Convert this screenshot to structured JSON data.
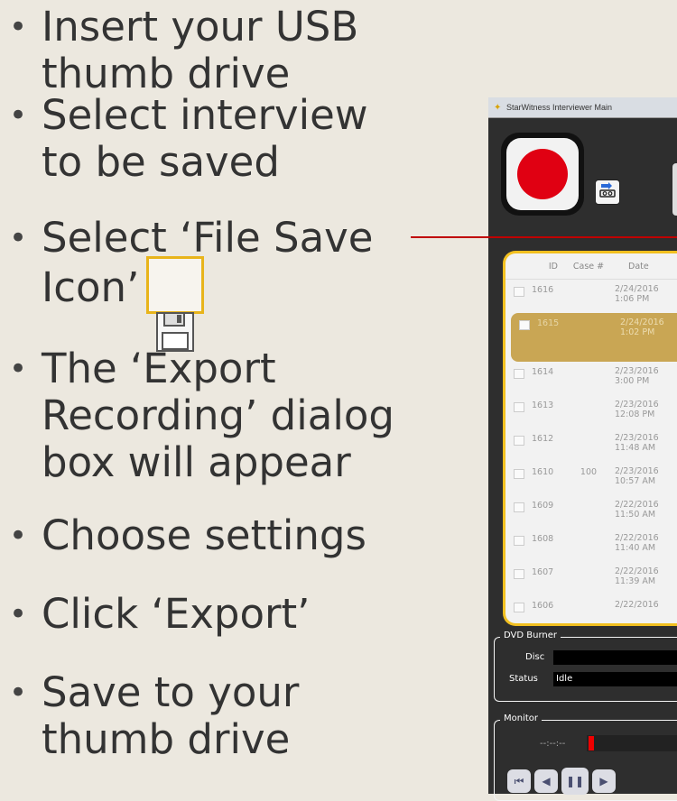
{
  "bullets": [
    {
      "glyph": "•",
      "text": "Insert your USB thumb drive"
    },
    {
      "glyph": "•",
      "text": "Select interview\nto be saved"
    },
    {
      "glyph": "•",
      "text": "Select ‘File Save\nIcon’"
    },
    {
      "glyph": "•",
      "text": "The ‘Export\nRecording’ dialog\nbox will appear"
    },
    {
      "glyph": "•",
      "text": "Choose settings"
    },
    {
      "glyph": "•",
      "text": "Click ‘Export’"
    },
    {
      "glyph": "•",
      "text": "Save to your\nthumb drive"
    }
  ],
  "colors": {
    "background": "#ece8df",
    "callout_line": "#c00000",
    "highlight_border": "#f2c020",
    "record_red": "#e00012"
  },
  "app": {
    "title": "StarWitness Interviewer Main",
    "list": {
      "headers": {
        "id": "ID",
        "case": "Case #",
        "date": "Date"
      },
      "rows": [
        {
          "id": "1616",
          "case": "",
          "date": "2/24/2016",
          "time": "1:06 PM",
          "selected": false
        },
        {
          "id": "1615",
          "case": "",
          "date": "2/24/2016",
          "time": "1:02 PM",
          "selected": true
        },
        {
          "id": "1614",
          "case": "",
          "date": "2/23/2016",
          "time": "3:00 PM",
          "selected": false
        },
        {
          "id": "1613",
          "case": "",
          "date": "2/23/2016",
          "time": "12:08 PM",
          "selected": false
        },
        {
          "id": "1612",
          "case": "",
          "date": "2/23/2016",
          "time": "11:48 AM",
          "selected": false
        },
        {
          "id": "1610",
          "case": "100",
          "date": "2/23/2016",
          "time": "10:57 AM",
          "selected": false
        },
        {
          "id": "1609",
          "case": "",
          "date": "2/22/2016",
          "time": "11:50 AM",
          "selected": false
        },
        {
          "id": "1608",
          "case": "",
          "date": "2/22/2016",
          "time": "11:40 AM",
          "selected": false
        },
        {
          "id": "1607",
          "case": "",
          "date": "2/22/2016",
          "time": "11:39 AM",
          "selected": false
        },
        {
          "id": "1606",
          "case": "",
          "date": "2/22/2016",
          "time": "",
          "selected": false
        }
      ]
    },
    "dvd": {
      "legend": "DVD Burner",
      "disc_label": "Disc",
      "disc_value": "",
      "status_label": "Status",
      "status_value": "Idle"
    },
    "monitor": {
      "legend": "Monitor",
      "time": "--:--:--"
    },
    "transport_icons": [
      "skip-back-icon",
      "step-back-icon",
      "pause-icon",
      "play-icon"
    ]
  }
}
